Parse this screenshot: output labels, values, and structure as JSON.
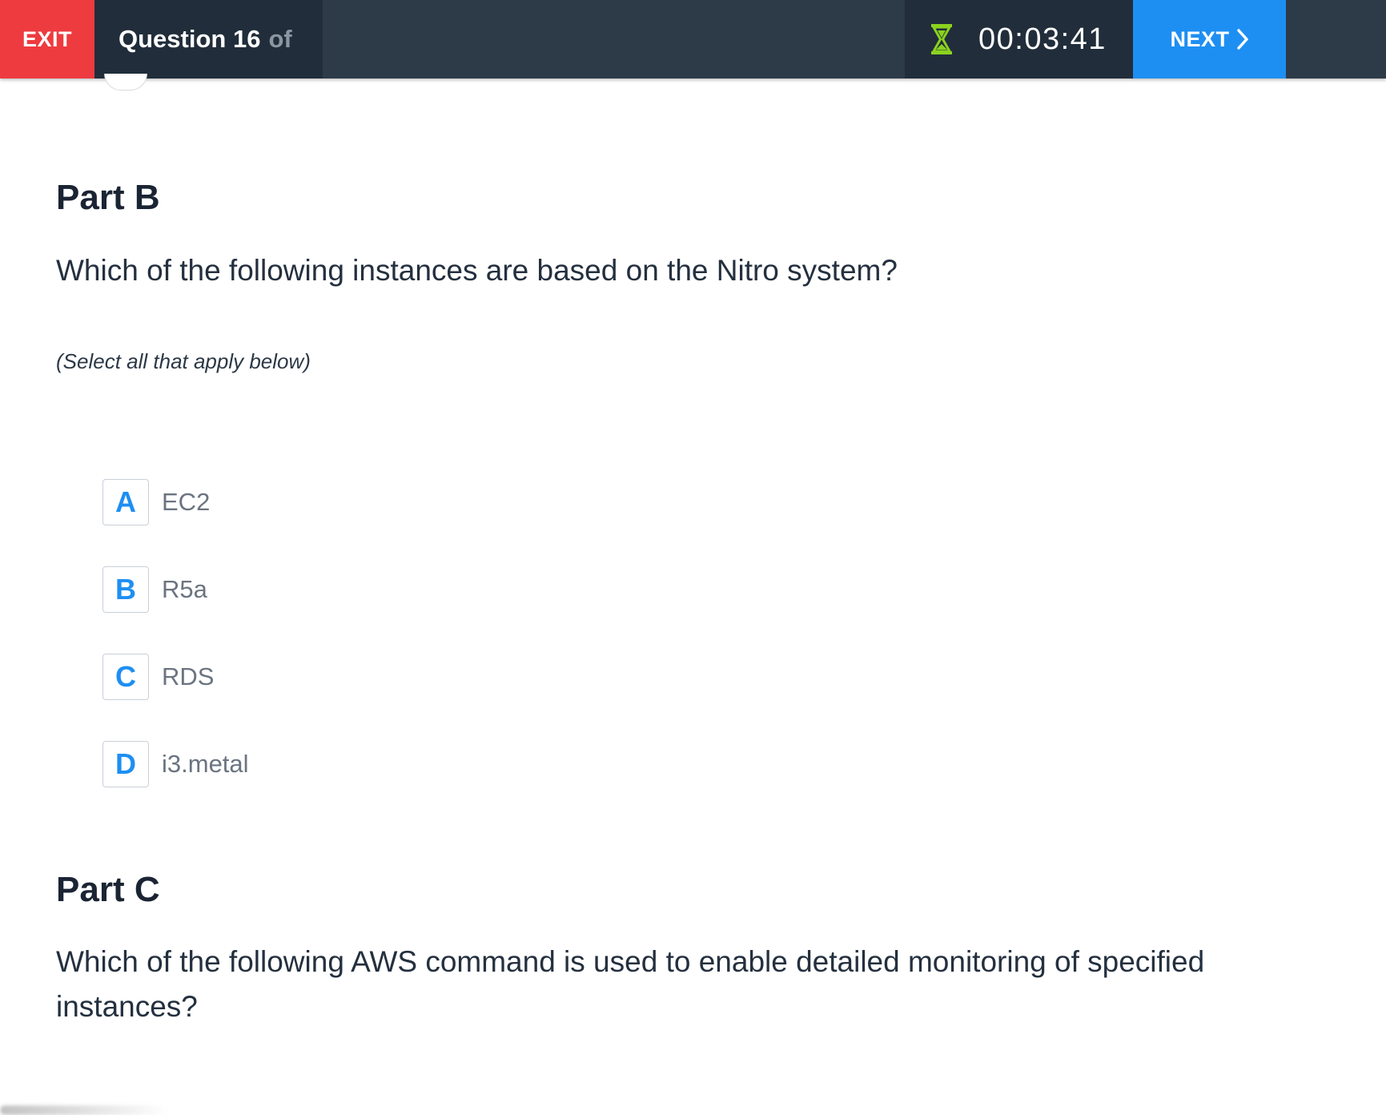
{
  "header": {
    "exit_label": "EXIT",
    "question_label": "Question 16",
    "question_of": "of",
    "timer": "00:03:41",
    "timer_icon": "hourglass-icon",
    "next_label": "NEXT",
    "next_icon": "chevron-right-icon"
  },
  "colors": {
    "topbar": "#2d3a48",
    "exit": "#ee3b3f",
    "next": "#1e8ff2",
    "timer_icon": "#8bd21f",
    "accent": "#1e8ff2"
  },
  "part_b": {
    "title": "Part B",
    "question": "Which of the following instances are based on the Nitro system?",
    "instruction": "(Select all that apply below)",
    "options": [
      {
        "letter": "A",
        "label": "EC2"
      },
      {
        "letter": "B",
        "label": "R5a"
      },
      {
        "letter": "C",
        "label": "RDS"
      },
      {
        "letter": "D",
        "label": "i3.metal"
      }
    ]
  },
  "part_c": {
    "title": "Part C",
    "question": "Which of the following AWS command is used to enable detailed monitoring of specified instances?"
  }
}
